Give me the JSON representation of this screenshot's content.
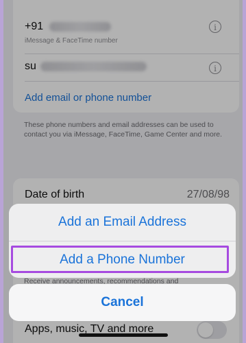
{
  "contacts": {
    "phone_prefix": "+91",
    "phone_subtitle": "iMessage & FaceTime number",
    "email_prefix": "su",
    "add_link": "Add email or phone number",
    "footnote": "These phone numbers and email addresses can be used to contact you via iMessage, FaceTime, Game Center and more."
  },
  "details": {
    "dob_label": "Date of birth",
    "dob_value": "27/08/98"
  },
  "background_partial": {
    "announcement_text": "Receive announcements, recommendations and",
    "apps_label": "Apps, music, TV and more"
  },
  "action_sheet": {
    "add_email": "Add an Email Address",
    "add_phone": "Add a Phone Number",
    "cancel": "Cancel"
  },
  "colors": {
    "accent": "#1a73d9",
    "highlight": "#a64ae0"
  }
}
